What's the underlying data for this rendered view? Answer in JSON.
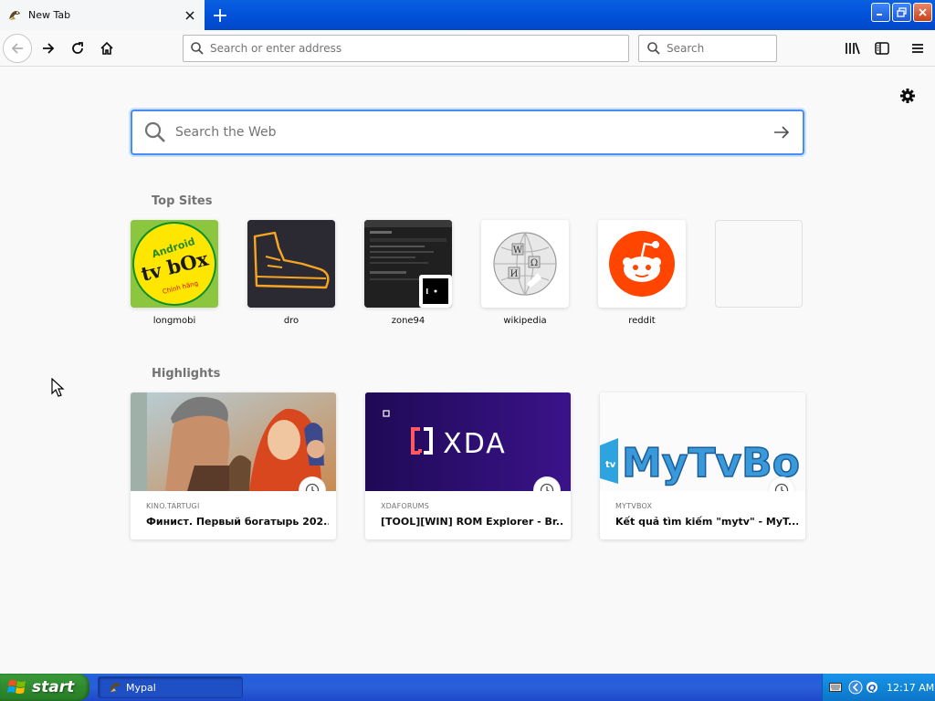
{
  "tab": {
    "title": "New Tab"
  },
  "urlbar": {
    "placeholder": "Search or enter address"
  },
  "searchbar": {
    "placeholder": "Search"
  },
  "newtab": {
    "search_placeholder": "Search the Web",
    "top_sites_heading": "Top Sites",
    "highlights_heading": "Highlights",
    "top_sites": [
      {
        "label": "longmobi",
        "logo_text": [
          "Android",
          "tv bOx",
          "Chính hãng"
        ]
      },
      {
        "label": "dro"
      },
      {
        "label": "zone94"
      },
      {
        "label": "wikipedia"
      },
      {
        "label": "reddit"
      },
      {
        "label": ""
      }
    ],
    "highlights": [
      {
        "source": "KINO.TARTUGI",
        "title": "Финист. Первый богатырь 202..."
      },
      {
        "source": "XDAFORUMS",
        "title": "[TOOL][WIN] ROM Explorer - Br...",
        "logo_text": "XDA"
      },
      {
        "source": "MYTVBOX",
        "title": "Kết quả tìm kiếm \"mytv\" - MyT...",
        "logo_text": "MyTvBo"
      }
    ]
  },
  "taskbar": {
    "start_label": "start",
    "window_label": "Mypal",
    "clock": "12:17 AM"
  },
  "colors": {
    "accent": "#0a84ff",
    "reddit": "#ff4500",
    "xda_bg": "#2a1168",
    "title_bar": "#0150d8",
    "start": "#2f8a2e"
  }
}
